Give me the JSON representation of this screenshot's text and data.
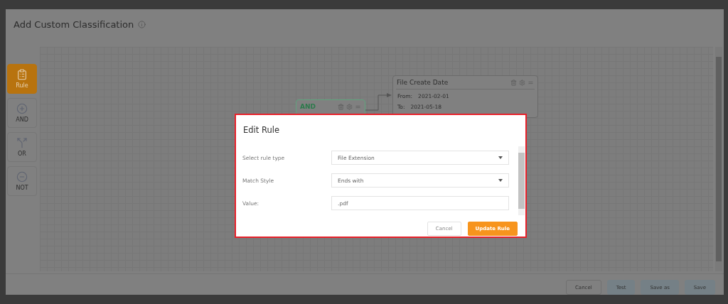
{
  "dialog": {
    "title": "Add Custom Classification"
  },
  "palette": [
    {
      "label": "Rule",
      "kind": "rule",
      "selected": true
    },
    {
      "label": "AND",
      "kind": "and",
      "selected": false
    },
    {
      "label": "OR",
      "kind": "or",
      "selected": false
    },
    {
      "label": "NOT",
      "kind": "not",
      "selected": false
    }
  ],
  "canvas": {
    "nodes": [
      {
        "kind": "and",
        "title": "AND"
      },
      {
        "kind": "rule",
        "title": "File Create Date",
        "fields": [
          {
            "label": "From:",
            "value": "2021-02-01"
          },
          {
            "label": "To:",
            "value": "2021-05-18"
          }
        ]
      }
    ]
  },
  "footer_buttons": [
    {
      "label": "Cancel",
      "kind": "secondary"
    },
    {
      "label": "Test",
      "kind": "primary"
    },
    {
      "label": "Save as",
      "kind": "primary"
    },
    {
      "label": "Save",
      "kind": "primary"
    }
  ],
  "edit_rule": {
    "title": "Edit Rule",
    "fields": [
      {
        "label": "Select rule type",
        "kind": "select",
        "value": "File Extension"
      },
      {
        "label": "Match Style",
        "kind": "select",
        "value": "Ends with"
      },
      {
        "label": "Value:",
        "kind": "text",
        "value": ".pdf"
      }
    ],
    "buttons": [
      {
        "label": "Cancel",
        "kind": "secondary"
      },
      {
        "label": "Update Rule",
        "kind": "primary"
      }
    ]
  }
}
